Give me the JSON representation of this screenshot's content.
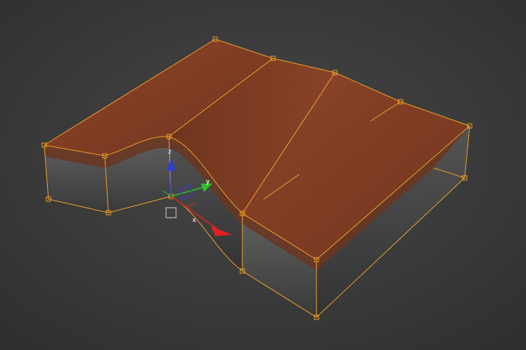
{
  "viewport": {
    "background_color": "#3b3b3b",
    "selection_color": "#f0a028",
    "top_surface_color": "#8e4529",
    "side_surface_color": "#505050",
    "rim_color": "#6b3520"
  },
  "gizmo": {
    "z_label": "z",
    "y_label": "y",
    "x_label": "x",
    "z_color": "#2a3cf0",
    "y_color": "#2ac02a",
    "x_color": "#e02020"
  }
}
